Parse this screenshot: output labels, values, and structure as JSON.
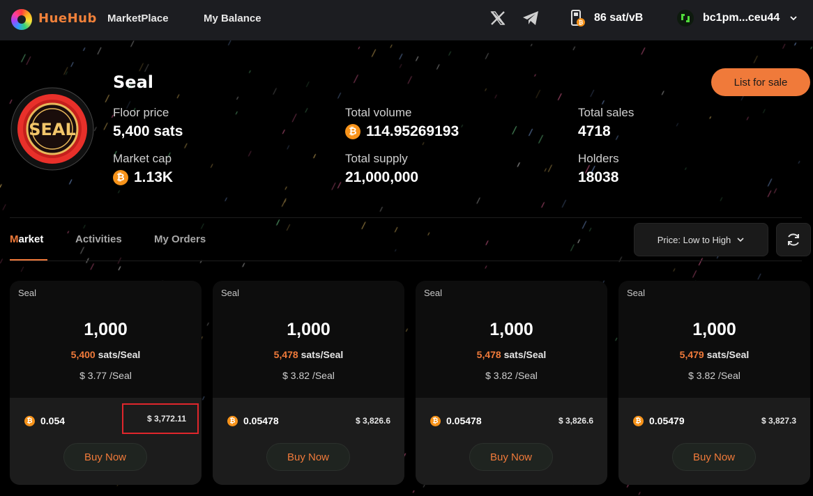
{
  "nav": {
    "brand": "HueHub",
    "links": [
      "MarketPlace",
      "My Balance"
    ],
    "gas_fee": "86 sat/vB",
    "wallet_address": "bc1pm...ceu44"
  },
  "collection": {
    "name": "Seal",
    "logo_text": "SEAL",
    "list_button": "List for sale",
    "stats": {
      "floor_price_label": "Floor price",
      "floor_price_value": "5,400 sats",
      "total_volume_label": "Total volume",
      "total_volume_value": "114.95269193",
      "total_sales_label": "Total sales",
      "total_sales_value": "4718",
      "market_cap_label": "Market cap",
      "market_cap_value": "1.13K",
      "total_supply_label": "Total supply",
      "total_supply_value": "21,000,000",
      "holders_label": "Holders",
      "holders_value": "18038"
    }
  },
  "tabs": [
    {
      "label_first": "M",
      "label_rest": "arket",
      "active": true
    },
    {
      "label": "Activities"
    },
    {
      "label": "My Orders"
    }
  ],
  "sort": {
    "label": "Price: Low to High"
  },
  "cards": [
    {
      "tick": "Seal",
      "amount": "1,000",
      "unit_price": "5,400",
      "unit_suffix": "sats/Seal",
      "usd_unit": "$ 3.77 /Seal",
      "btc_total": "0.054",
      "usd_total": "$ 3,772.11",
      "buy_label": "Buy Now"
    },
    {
      "tick": "Seal",
      "amount": "1,000",
      "unit_price": "5,478",
      "unit_suffix": "sats/Seal",
      "usd_unit": "$ 3.82 /Seal",
      "btc_total": "0.05478",
      "usd_total": "$ 3,826.6",
      "buy_label": "Buy Now"
    },
    {
      "tick": "Seal",
      "amount": "1,000",
      "unit_price": "5,478",
      "unit_suffix": "sats/Seal",
      "usd_unit": "$ 3.82 /Seal",
      "btc_total": "0.05478",
      "usd_total": "$ 3,826.6",
      "buy_label": "Buy Now"
    },
    {
      "tick": "Seal",
      "amount": "1,000",
      "unit_price": "5,479",
      "unit_suffix": "sats/Seal",
      "usd_unit": "$ 3.82 /Seal",
      "btc_total": "0.05479",
      "usd_total": "$ 3,827.3",
      "buy_label": "Buy Now"
    }
  ],
  "colors": {
    "accent": "#f07a3a",
    "bitcoin": "#f7931a",
    "highlight_box": "#e0262c",
    "background": "#000000",
    "nav_bg": "#1c1d21"
  }
}
